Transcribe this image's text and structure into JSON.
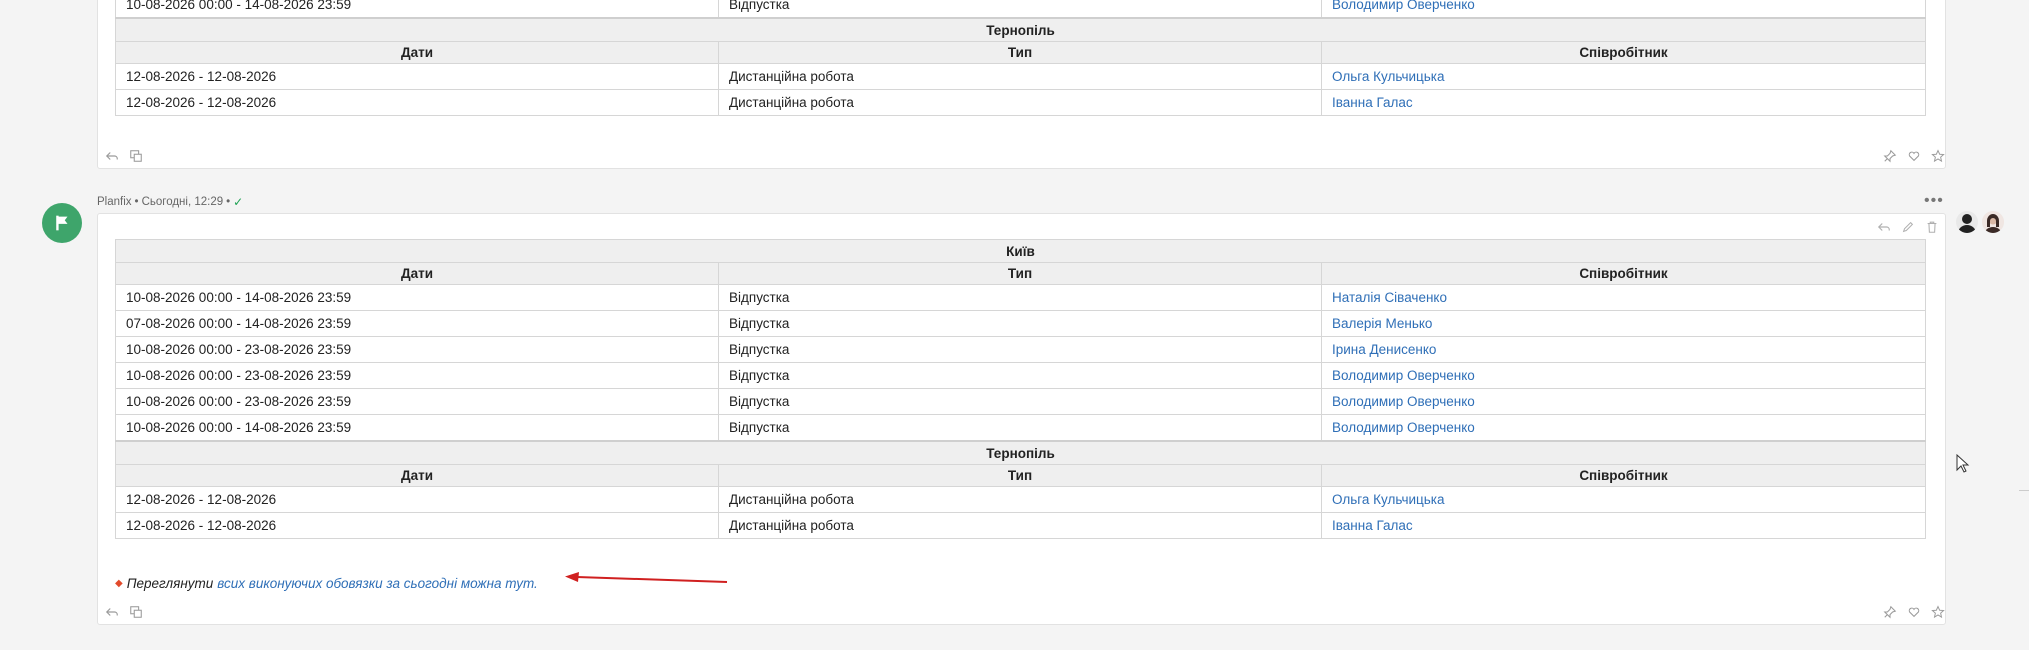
{
  "columns": {
    "dates": "Дати",
    "type": "Тип",
    "employee": "Співробітник"
  },
  "top_message": {
    "first_row": {
      "dates": "10-08-2026 00:00 - 14-08-2026 23:59",
      "type": "Відпустка",
      "employee": "Володимир Оверченко"
    },
    "sections": [
      {
        "city": "Тернопіль",
        "rows": [
          {
            "dates": "12-08-2026 - 12-08-2026",
            "type": "Дистанційна робота",
            "employee": "Ольга Кульчицька"
          },
          {
            "dates": "12-08-2026 - 12-08-2026",
            "type": "Дистанційна робота",
            "employee": "Іванна Галас"
          }
        ]
      }
    ]
  },
  "message": {
    "author": "Planfix",
    "separator": "•",
    "time": "Сьогодні, 12:29",
    "more": "•••",
    "sections": [
      {
        "city": "Київ",
        "rows": [
          {
            "dates": "10-08-2026 00:00 - 14-08-2026 23:59",
            "type": "Відпустка",
            "employee": "Наталія Сіваченко"
          },
          {
            "dates": "07-08-2026 00:00 - 14-08-2026 23:59",
            "type": "Відпустка",
            "employee": "Валерія Менько"
          },
          {
            "dates": "10-08-2026 00:00 - 23-08-2026 23:59",
            "type": "Відпустка",
            "employee": "Ірина Денисенко"
          },
          {
            "dates": "10-08-2026 00:00 - 23-08-2026 23:59",
            "type": "Відпустка",
            "employee": "Володимир Оверченко"
          },
          {
            "dates": "10-08-2026 00:00 - 23-08-2026 23:59",
            "type": "Відпустка",
            "employee": "Володимир Оверченко"
          },
          {
            "dates": "10-08-2026 00:00 - 14-08-2026 23:59",
            "type": "Відпустка",
            "employee": "Володимир Оверченко"
          }
        ]
      },
      {
        "city": "Тернопіль",
        "rows": [
          {
            "dates": "12-08-2026 - 12-08-2026",
            "type": "Дистанційна робота",
            "employee": "Ольга Кульчицька"
          },
          {
            "dates": "12-08-2026 - 12-08-2026",
            "type": "Дистанційна робота",
            "employee": "Іванна Галас"
          }
        ]
      }
    ],
    "note": {
      "prefix": "Переглянути",
      "link": "всих виконуючих обовязки за сьогодні можна тут."
    }
  },
  "icons": {
    "reply": "reply-icon",
    "quote": "quote-icon",
    "pin": "pin-icon",
    "like": "heart-icon",
    "star": "star-icon",
    "edit": "pencil-icon",
    "delete": "trash-icon"
  },
  "colors": {
    "link": "#2f6fb7",
    "avatar": "#3ea56b",
    "arrow": "#d02020",
    "check": "#1fa254"
  }
}
